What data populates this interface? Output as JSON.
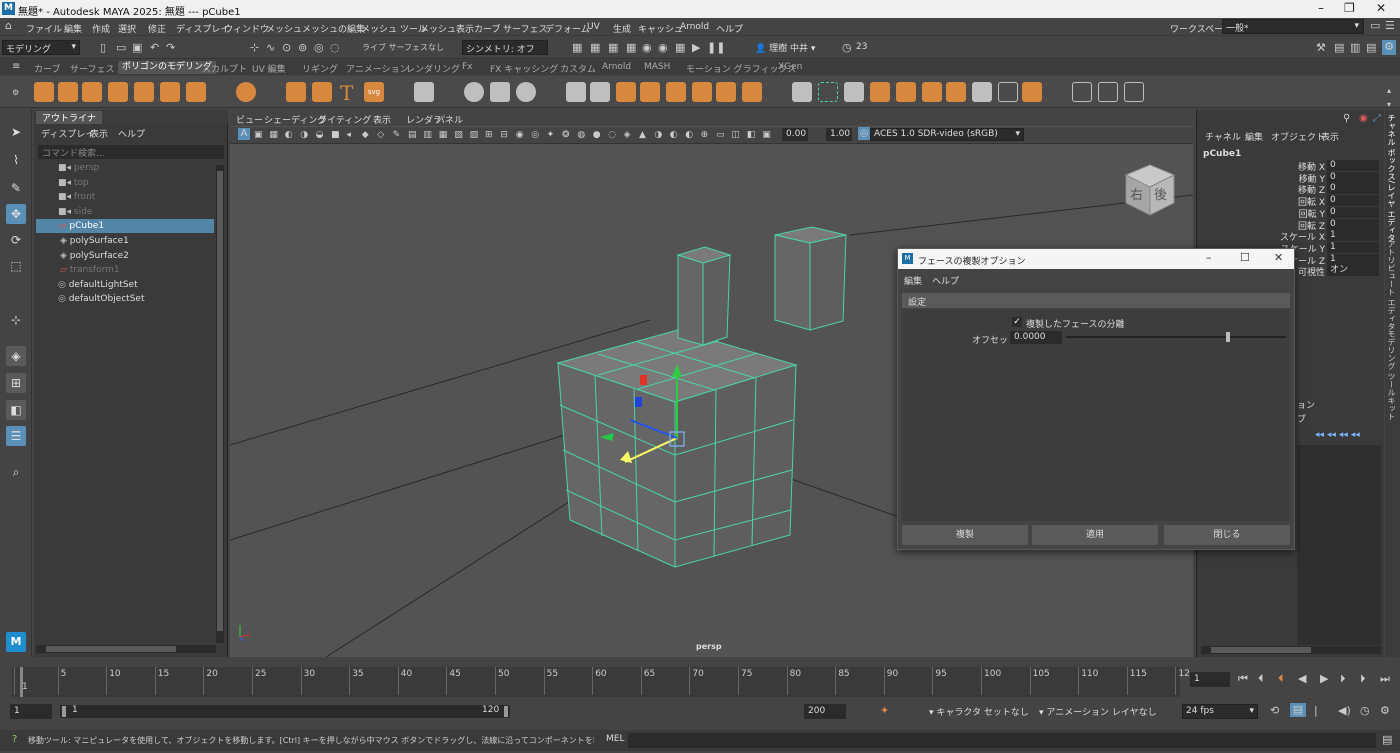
{
  "window": {
    "title": "無題* - Autodesk MAYA 2025: 無題   ---   pCube1",
    "app_badge": "M"
  },
  "menubar": {
    "items": [
      "ファイル",
      "編集",
      "作成",
      "選択",
      "修正",
      "ディスプレイ",
      "ウィンドウ",
      "メッシュ",
      "メッシュの編集",
      "メッシュ ツール",
      "メッシュ表示",
      "カーブ",
      "サーフェス",
      "デフォーム",
      "UV",
      "生成",
      "キャッシュ",
      "Arnold",
      "ヘルプ"
    ],
    "workspace_label": "ワークスペース:",
    "workspace_value": "一般*"
  },
  "statusline": {
    "mode": "モデリング",
    "live_label": "ライブ サーフェスなし",
    "symmetry": "シンメトリ: オフ",
    "user": "理樹 中井",
    "notifications": "23"
  },
  "shelf": {
    "tabs": [
      "カーブ",
      "サーフェス",
      "ポリゴンのモデリング",
      "スカルプト",
      "UV 編集",
      "リギング",
      "アニメーション",
      "レンダリング",
      "Fx",
      "FX キャッシング",
      "カスタム",
      "Arnold",
      "MASH",
      "モーション グラフィックス",
      "XGen"
    ],
    "active_tab": "ポリゴンのモデリング",
    "svg_icon_text": "svg",
    "text_icon": "T"
  },
  "outliner": {
    "tab": "アウトライナ",
    "menu": [
      "ディスプレイ",
      "表示",
      "ヘルプ"
    ],
    "search_placeholder": "コマンド検索...",
    "items": [
      {
        "label": "persp",
        "dim": true,
        "indent": 0
      },
      {
        "label": "top",
        "dim": true,
        "indent": 0
      },
      {
        "label": "front",
        "dim": true,
        "indent": 0
      },
      {
        "label": "side",
        "dim": true,
        "indent": 0
      },
      {
        "label": "pCube1",
        "dim": false,
        "indent": 0,
        "selected": true
      },
      {
        "label": "polySurface1",
        "dim": false,
        "indent": 1
      },
      {
        "label": "polySurface2",
        "dim": false,
        "indent": 1
      },
      {
        "label": "transform1",
        "dim": true,
        "indent": 1
      },
      {
        "label": "defaultLightSet",
        "dim": false,
        "indent": 0
      },
      {
        "label": "defaultObjectSet",
        "dim": false,
        "indent": 0
      }
    ]
  },
  "viewport": {
    "menu": [
      "ビュー",
      "シェーディング",
      "ライティング",
      "表示",
      "レンダラ",
      "パネル"
    ],
    "value1": "0.00",
    "value2": "1.00",
    "colorspace": "ACES 1.0 SDR-video (sRGB)",
    "camera": "persp",
    "viewcube_right": "右",
    "viewcube_back": "後"
  },
  "channelbox": {
    "menu": [
      "チャネル",
      "編集",
      "オブジェクト",
      "表示"
    ],
    "object": "pCube1",
    "attrs": [
      {
        "label": "移動 X",
        "value": "0"
      },
      {
        "label": "移動 Y",
        "value": "0"
      },
      {
        "label": "移動 Z",
        "value": "0"
      },
      {
        "label": "回転 X",
        "value": "0"
      },
      {
        "label": "回転 Y",
        "value": "0"
      },
      {
        "label": "回転 Z",
        "value": "0"
      },
      {
        "label": "スケール X",
        "value": "1"
      },
      {
        "label": "スケール Y",
        "value": "1"
      },
      {
        "label": "スケール Z",
        "value": "1"
      },
      {
        "label": "可視性",
        "value": "オン"
      }
    ],
    "partial_label1": "ョン",
    "partial_label2": "ブ"
  },
  "sidetabs": [
    "チャネル ボックス/レイヤ エディタ",
    "アトリビュート エディタ",
    "モデリング ツールキット"
  ],
  "dialog": {
    "title": "フェースの複製オプション",
    "menu": [
      "編集",
      "ヘルプ"
    ],
    "section": "設定",
    "checkbox_label": "複製したフェースの分離",
    "checkbox_checked": true,
    "offset_label": "オフセット:",
    "offset_value": "0.0000",
    "offset_slider_fraction": 0.5,
    "buttons": [
      "複製",
      "適用",
      "閉じる"
    ]
  },
  "timeline": {
    "ticks": [
      "1",
      "5",
      "10",
      "15",
      "20",
      "25",
      "30",
      "35",
      "40",
      "45",
      "50",
      "55",
      "60",
      "65",
      "70",
      "75",
      "80",
      "85",
      "90",
      "95",
      "100",
      "105",
      "110",
      "115",
      "12"
    ],
    "current_frame": "1"
  },
  "range": {
    "start": "1",
    "inner_start": "1",
    "inner_end": "120",
    "end": "200",
    "character_set": "キャラクタ セットなし",
    "anim_layer": "アニメーション レイヤなし",
    "fps": "24 fps"
  },
  "helpline": {
    "text": "移動ツール: マニピュレータを使用して、オブジェクトを移動します。[Ctrl] キーを押しながら中マウス ボタンでドラッグし、法線に沿ってコンポーネントを移動します。[Shift] キーを押しながらマニピ",
    "mel_label": "MEL"
  },
  "colors": {
    "accent": "#5285a6",
    "shelf_orange": "#d8883e",
    "wire": "#4bd4a3"
  }
}
